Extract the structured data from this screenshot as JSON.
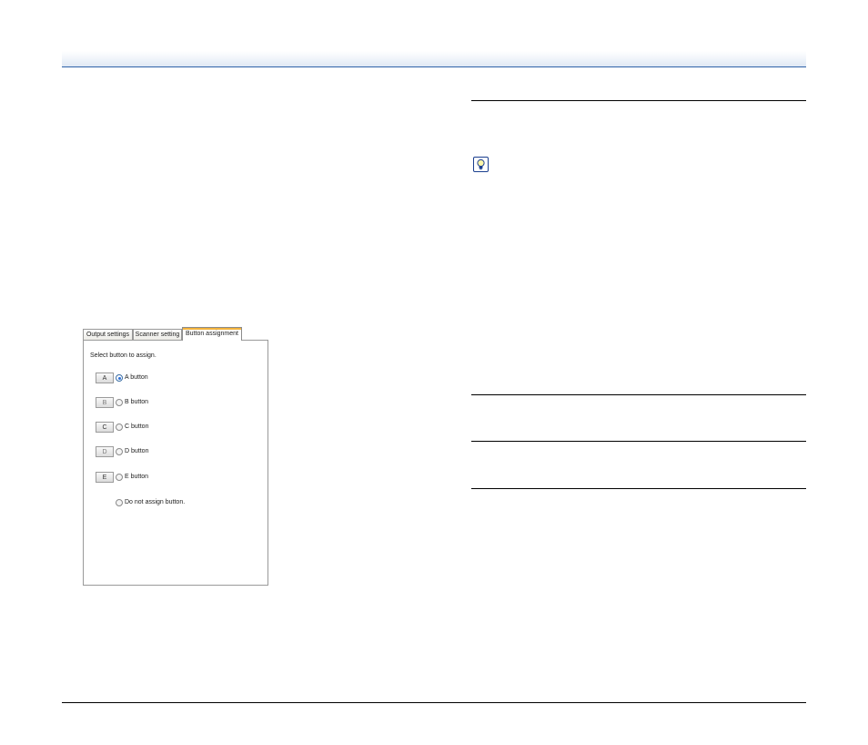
{
  "dialog": {
    "tabs": [
      {
        "label": "Output settings"
      },
      {
        "label": "Scanner setting"
      },
      {
        "label": "Button assignment"
      }
    ],
    "prompt": "Select button to assign.",
    "options": [
      {
        "key": "A",
        "label": "A button",
        "selected": true
      },
      {
        "key": "B",
        "label": "B button",
        "selected": false
      },
      {
        "key": "C",
        "label": "C button",
        "selected": false
      },
      {
        "key": "D",
        "label": "D button",
        "selected": false
      },
      {
        "key": "E",
        "label": "E button",
        "selected": false
      },
      {
        "key": "",
        "label": "Do not assign button.",
        "selected": false
      }
    ]
  },
  "icons": {
    "hint": "lightbulb-hint-icon"
  },
  "colors": {
    "header_rule": "#2e62a8",
    "hint_icon": "#1b3f8f",
    "active_tab_accent": "#f3b33d"
  }
}
